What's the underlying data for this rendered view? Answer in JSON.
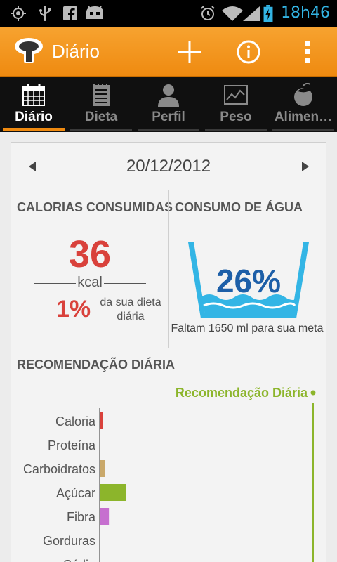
{
  "status_bar": {
    "time": "18h46",
    "icons": [
      "gps-icon",
      "usb-icon",
      "facebook-icon",
      "android-icon",
      "alarm-icon",
      "wifi-icon",
      "signal-icon",
      "battery-icon"
    ],
    "time_color": "#33b5e5"
  },
  "action_bar": {
    "title": "Diário",
    "accent": "#ef8a10",
    "icons": [
      "app-logo-icon",
      "add-icon",
      "info-icon",
      "overflow-menu-icon"
    ]
  },
  "tabs": [
    {
      "label": "Diário",
      "icon": "calendar-icon",
      "active": true
    },
    {
      "label": "Dieta",
      "icon": "notebook-icon",
      "active": false
    },
    {
      "label": "Perfil",
      "icon": "person-icon",
      "active": false
    },
    {
      "label": "Peso",
      "icon": "chart-icon",
      "active": false
    },
    {
      "label": "Alimen…",
      "icon": "food-icon",
      "active": false
    }
  ],
  "date": {
    "value": "20/12/2012",
    "prev_icon": "left-arrow-icon",
    "next_icon": "right-arrow-icon"
  },
  "calories": {
    "heading": "CALORIAS CONSUMIDAS",
    "value": "36",
    "unit": "kcal",
    "percent": "1%",
    "percent_desc": "da sua dieta diária",
    "color": "#d9413b"
  },
  "water": {
    "heading": "CONSUMO DE ÁGUA",
    "percent": "26%",
    "caption": "Faltam 1650 ml para sua meta",
    "level": 0.26,
    "color": "#33b5e5"
  },
  "recommendation": {
    "heading": "RECOMENDAÇÃO DIÁRIA",
    "legend": "Recomendação Diária",
    "legend_color": "#8cb52b"
  },
  "chart_data": {
    "type": "bar",
    "orientation": "horizontal",
    "categories": [
      "Caloria",
      "Proteína",
      "Carboidratos",
      "Açúcar",
      "Fibra",
      "Gorduras",
      "Sódio"
    ],
    "values": [
      1,
      0,
      2,
      12,
      4,
      0,
      0
    ],
    "colors": [
      "#d9413b",
      "#3aa0a0",
      "#c9a86a",
      "#8cb52b",
      "#c66fcf",
      "#e08a30",
      "#6688cc"
    ],
    "reference_line": 100,
    "xlim": [
      0,
      100
    ]
  }
}
